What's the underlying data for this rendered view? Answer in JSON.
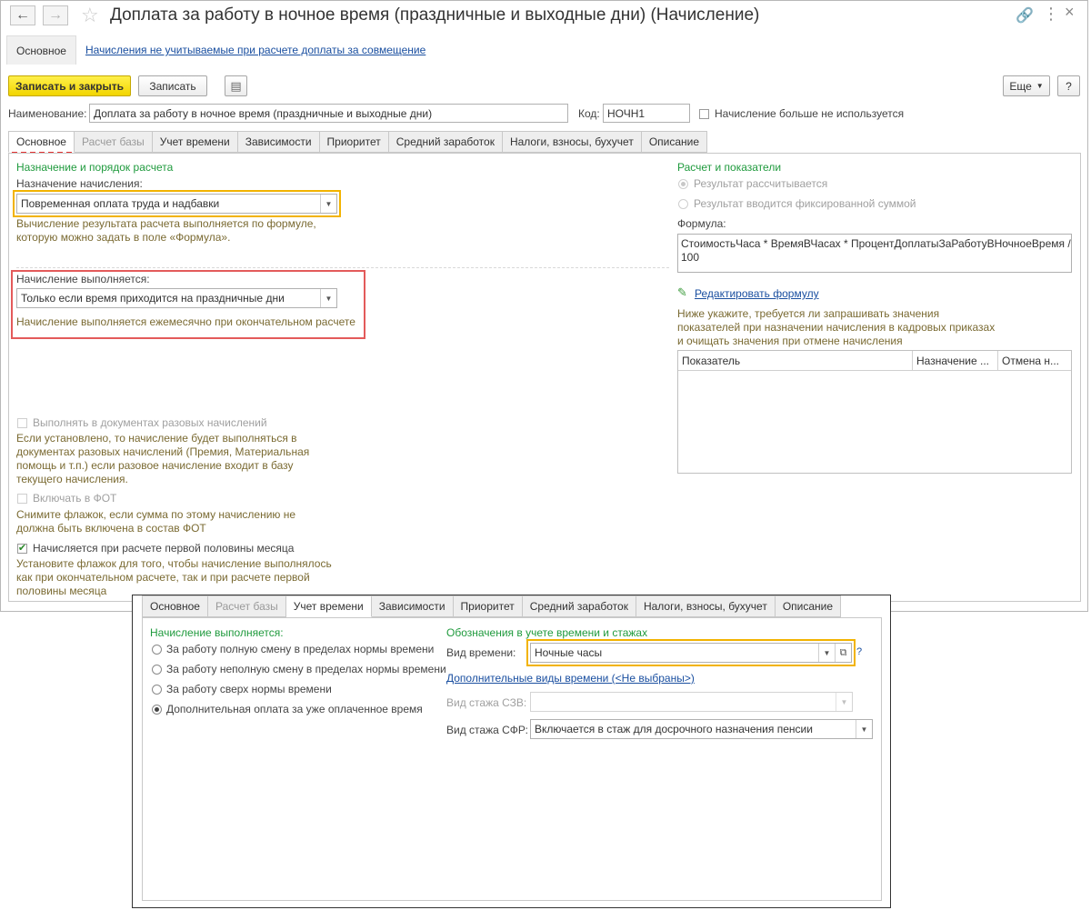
{
  "window": {
    "title": "Доплата за работу в ночное время (праздничные и выходные дни) (Начисление)"
  },
  "top_tabs": {
    "main": "Основное",
    "link": "Начисления не учитываемые при расчете доплаты за совмещение"
  },
  "toolbar": {
    "save_close": "Записать и закрыть",
    "save": "Записать",
    "more": "Еще",
    "help": "?"
  },
  "fields": {
    "name_label": "Наименование:",
    "name_value": "Доплата за работу в ночное время (праздничные и выходные дни)",
    "code_label": "Код:",
    "code_value": "НОЧН1",
    "unused_label": "Начисление больше не используется"
  },
  "tabs": [
    "Основное",
    "Расчет базы",
    "Учет времени",
    "Зависимости",
    "Приоритет",
    "Средний заработок",
    "Налоги, взносы, бухучет",
    "Описание"
  ],
  "main_tab": {
    "purpose_section": "Назначение и порядок расчета",
    "purpose_label": "Назначение начисления:",
    "purpose_value": "Повременная оплата труда и надбавки",
    "purpose_hint_1": "Вычисление результата расчета выполняется по формуле,",
    "purpose_hint_2": "которую можно задать в поле «Формула».",
    "perform_label": "Начисление выполняется:",
    "perform_value": "Только если время приходится на праздничные дни",
    "perform_hint": "Начисление выполняется ежемесячно при окончательном расчете",
    "onetime_label": "Выполнять в документах разовых начислений",
    "onetime_hint_1": "Если установлено, то начисление будет выполняться в",
    "onetime_hint_2": "документах разовых начислений (Премия, Материальная",
    "onetime_hint_3": "помощь и т.п.) если разовое начисление входит в базу",
    "onetime_hint_4": "текущего начисления.",
    "fot_label": "Включать в ФОТ",
    "fot_hint_1": "Снимите флажок, если сумма по этому начислению не",
    "fot_hint_2": "должна быть включена в состав ФОТ",
    "firsthalf_label": "Начисляется при расчете первой половины месяца",
    "firsthalf_hint_1": "Установите флажок для того, чтобы начисление выполнялось",
    "firsthalf_hint_2": "как при окончательном расчете, так и при расчете первой",
    "firsthalf_hint_3": "половины месяца",
    "calc_section": "Расчет и показатели",
    "result_calculated": "Результат рассчитывается",
    "result_fixed": "Результат вводится фиксированной суммой",
    "formula_label": "Формула:",
    "formula_line_1": "СтоимостьЧаса * ВремяВЧасах * ПроцентДоплатыЗаРаботуВНочноеВремя /",
    "formula_line_2": "100",
    "edit_formula": "Редактировать формулу",
    "indicators_hint_1": "Ниже укажите, требуется ли запрашивать значения",
    "indicators_hint_2": "показателей при назначении начисления в кадровых приказах",
    "indicators_hint_3": "и очищать значения при отмене начисления",
    "table_headers": [
      "Показатель",
      "Назначение ...",
      "Отмена н..."
    ]
  },
  "time_tab": {
    "perform_section": "Начисление выполняется:",
    "options": [
      "За работу полную смену в пределах нормы времени",
      "За работу неполную смену в пределах нормы времени",
      "За работу сверх нормы времени",
      "Дополнительная оплата за уже оплаченное время"
    ],
    "selected_index": 3,
    "designations_section": "Обозначения в учете времени и стажах",
    "time_type_label": "Вид времени:",
    "time_type_value": "Ночные часы",
    "extra_types_link": "Дополнительные виды времени (<Не выбраны>)",
    "szv_label": "Вид стажа СЗВ:",
    "sfr_label": "Вид стажа СФР:",
    "sfr_value": "Включается в стаж для досрочного назначения пенсии",
    "help": "?"
  }
}
